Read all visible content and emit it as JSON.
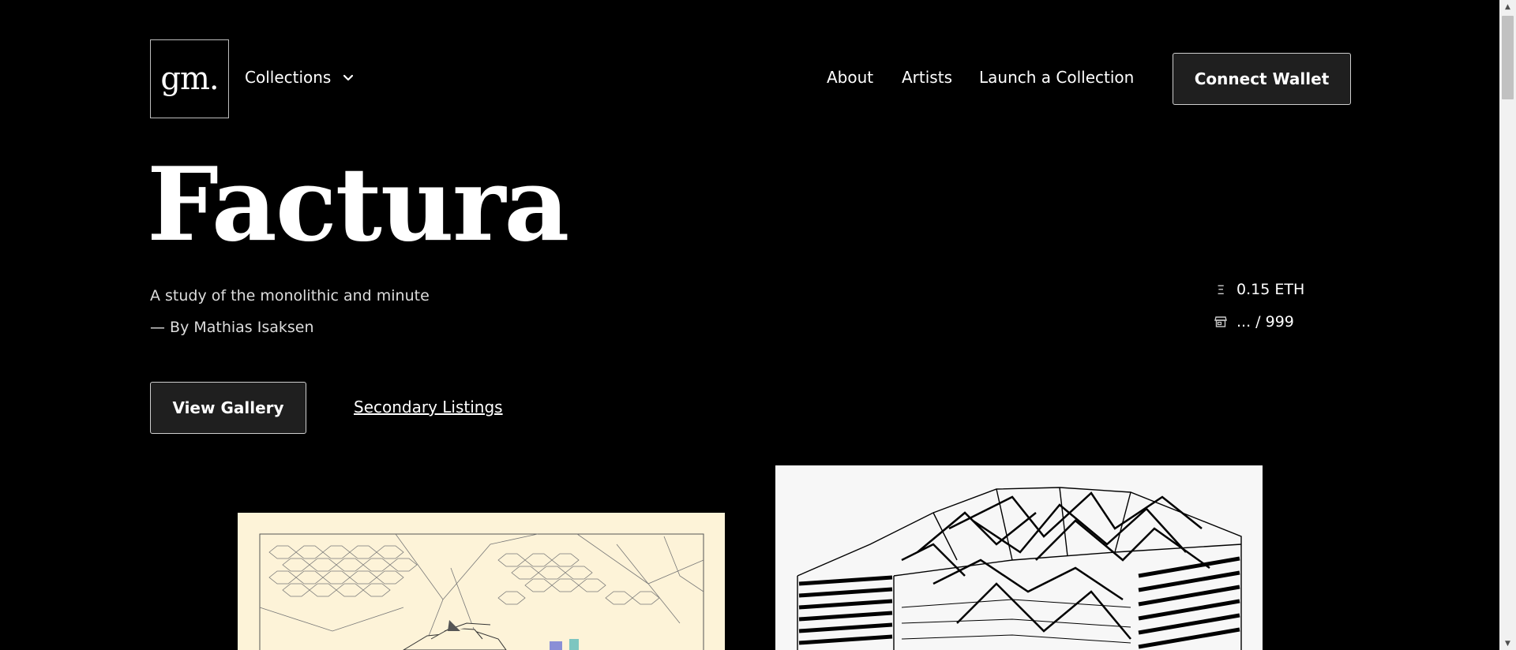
{
  "header": {
    "logo_text": "gm.",
    "collections_label": "Collections",
    "nav": {
      "about": "About",
      "artists": "Artists",
      "launch": "Launch a Collection"
    },
    "connect_wallet_label": "Connect Wallet"
  },
  "hero": {
    "title": "Factura",
    "subtitle": "A study of the monolithic and minute",
    "byline": "— By Mathias Isaksen",
    "price": "0.15 ETH",
    "price_icon": "Ξ",
    "supply": "... / 999",
    "view_gallery_label": "View Gallery",
    "secondary_listings_label": "Secondary Listings"
  },
  "colors": {
    "background": "#000000",
    "button_bg": "#1f1f1f",
    "art_1_bg": "#fdf3d8",
    "art_2_bg": "#f7f7f7"
  },
  "icons": [
    "chevron-down-icon",
    "ethereum-icon",
    "storefront-icon",
    "scroll-up-arrow-icon",
    "scroll-down-arrow-icon"
  ]
}
